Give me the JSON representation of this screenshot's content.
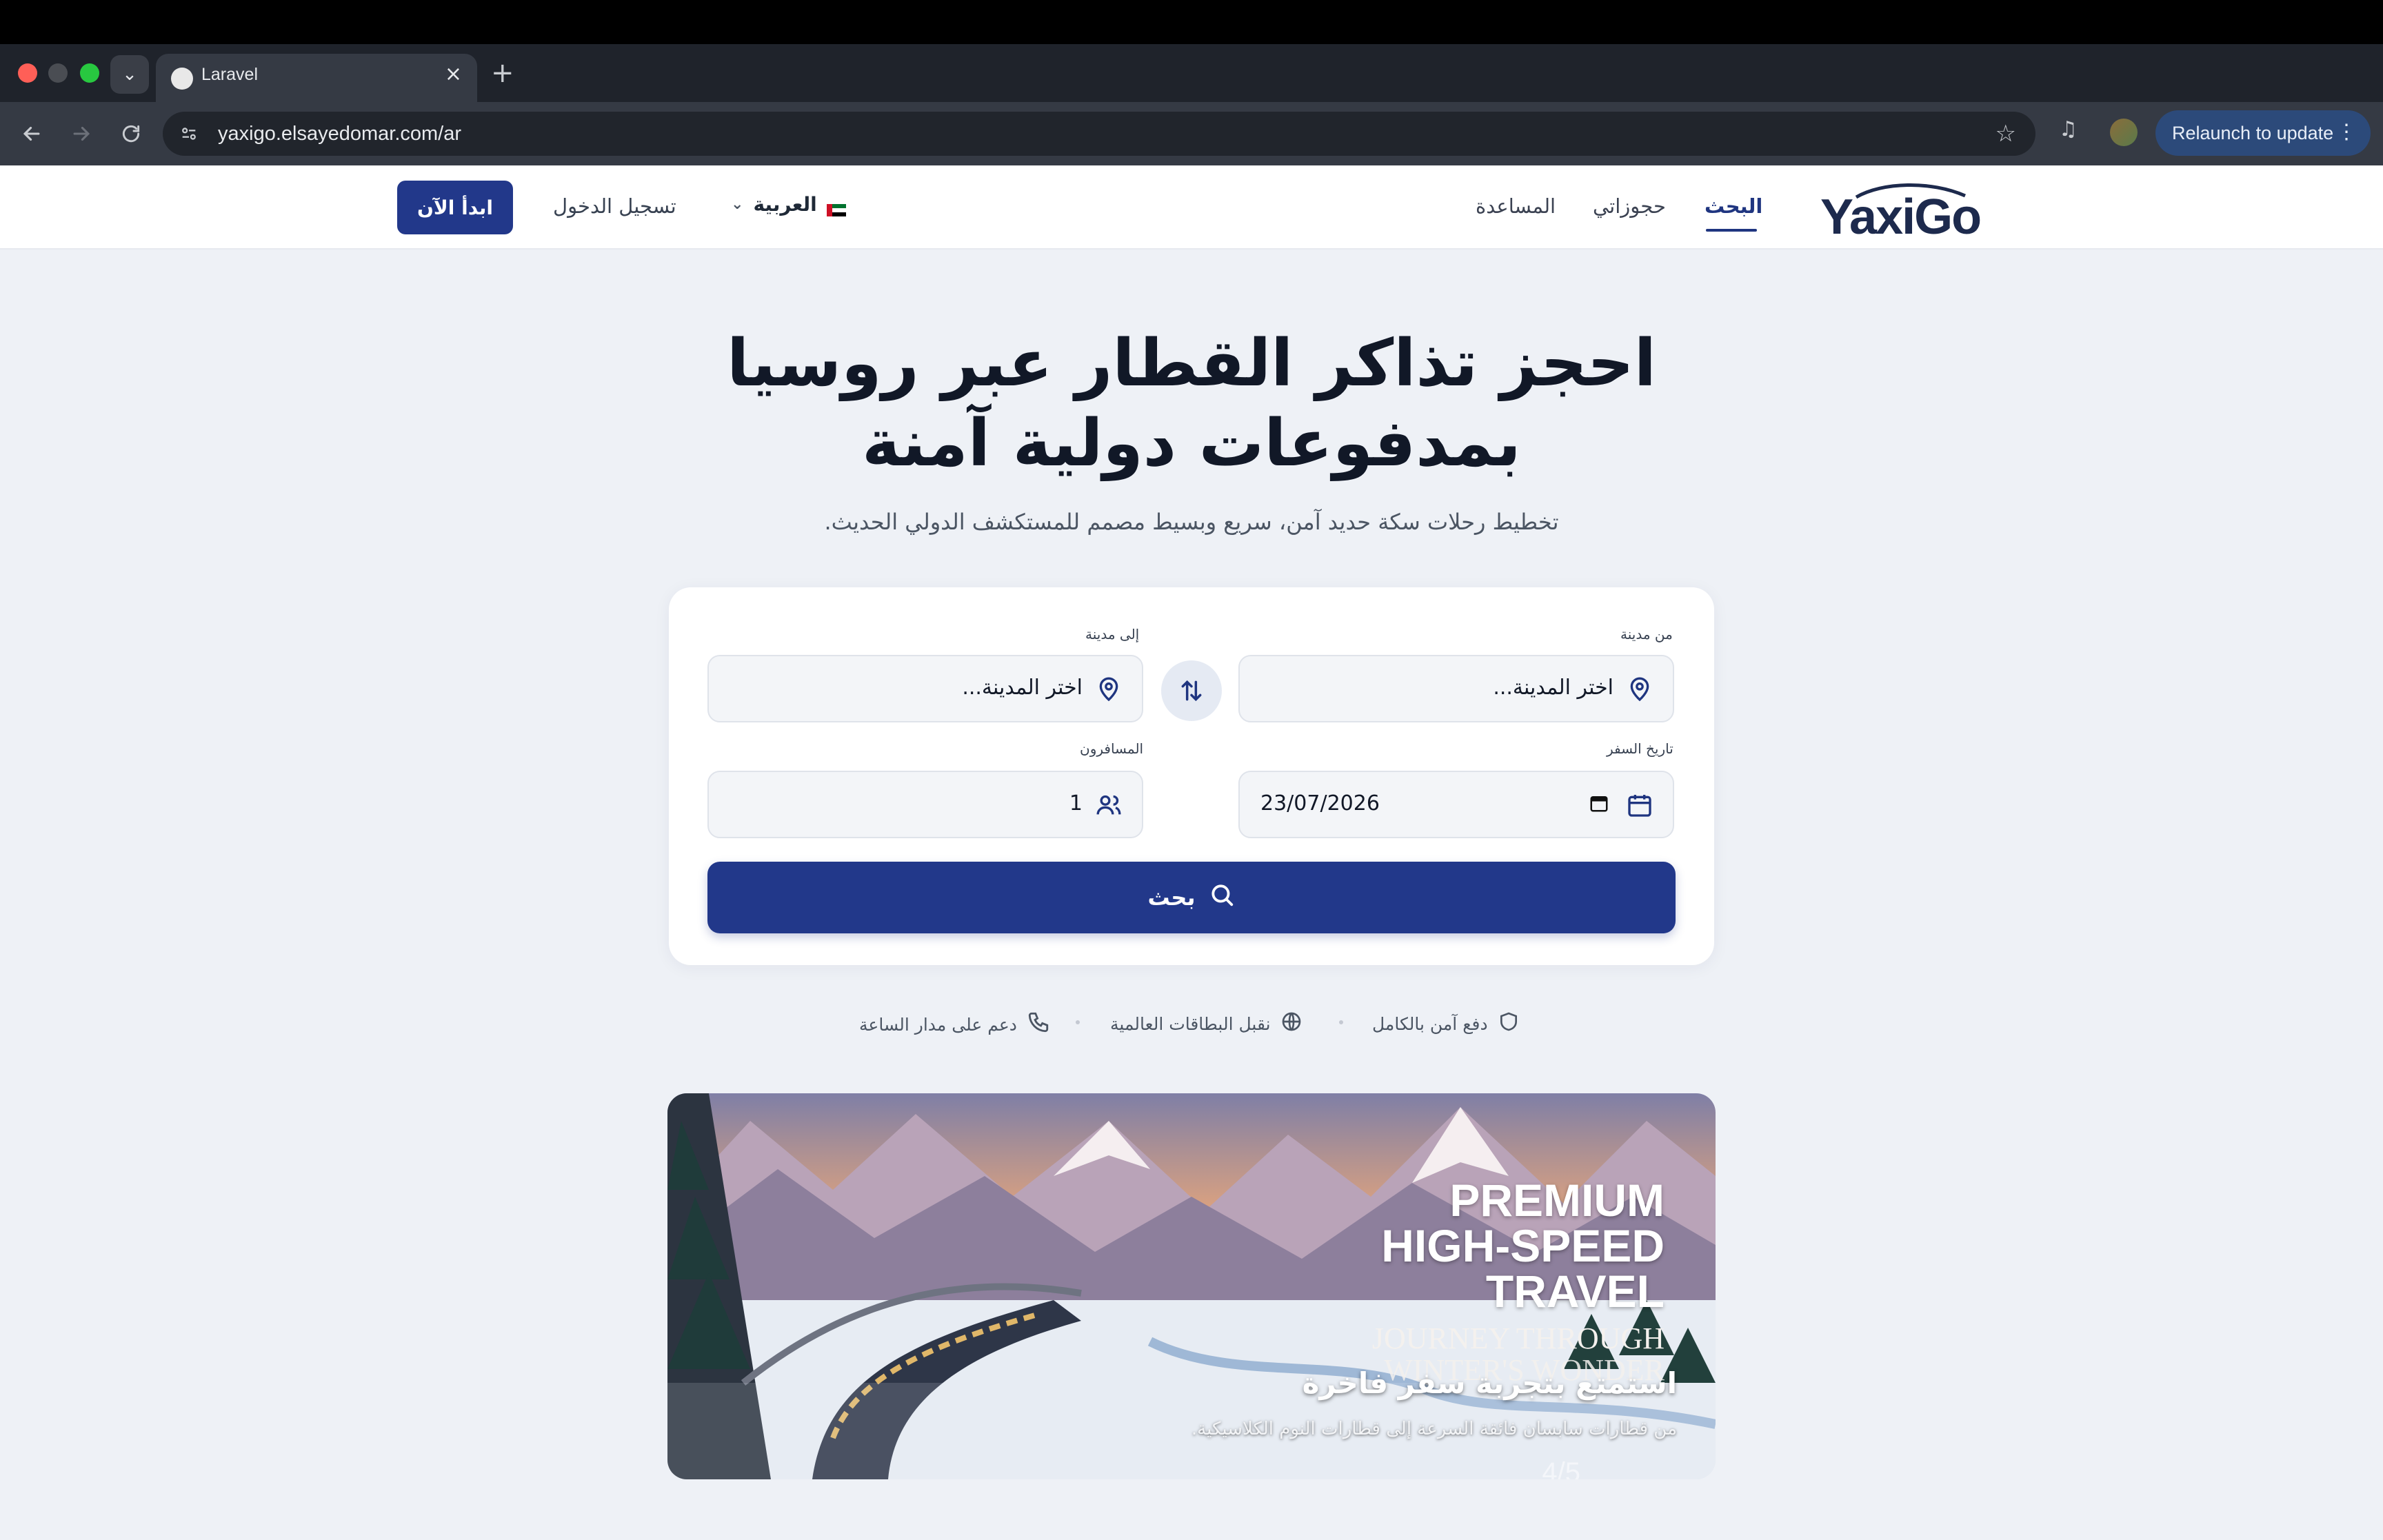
{
  "browser": {
    "tab_title": "Laravel",
    "url": "yaxigo.elsayedomar.com/ar",
    "relaunch_label": "Relaunch to update"
  },
  "header": {
    "logo_text": "YaxiGo",
    "nav": {
      "search": "البحث",
      "bookings": "حجوزاتي",
      "help": "المساعدة"
    },
    "language": "العربية",
    "login": "تسجيل الدخول",
    "start": "ابدأ الآن"
  },
  "hero": {
    "title_line1": "احجز تذاكر القطار عبر روسيا",
    "title_line2": "بمدفوعات دولية آمنة",
    "subtitle": "تخطيط رحلات سكة حديد آمن، سريع وبسيط مصمم للمستكشف الدولي الحديث."
  },
  "search_form": {
    "from_label": "من مدينة",
    "from_placeholder": "اختر المدينة...",
    "to_label": "إلى مدينة",
    "to_placeholder": "اختر المدينة...",
    "date_label": "تاريخ السفر",
    "date_value": "23/07/2026",
    "passengers_label": "المسافرون",
    "passengers_value": "1",
    "search_button": "بحث"
  },
  "features": {
    "secure_payment": "دفع آمن بالكامل",
    "global_cards": "نقبل البطاقات العالمية",
    "support": "دعم على مدار الساعة"
  },
  "banner": {
    "line1": "PREMIUM",
    "line2": "HIGH-SPEED",
    "line3": "TRAVEL",
    "line4": "JOURNEY THROUGH",
    "line5": "WINTER'S WONDER",
    "ar_title": "استمتع بتجربة سفر فاخرة",
    "ar_subtitle": "من قطارات سابسان فائقة السرعة إلى قطارات النوم الكلاسيكية.",
    "counter": "4/5"
  },
  "colors": {
    "primary": "#22388a",
    "background": "#eef1f6",
    "browser_dark": "#1f232b"
  }
}
